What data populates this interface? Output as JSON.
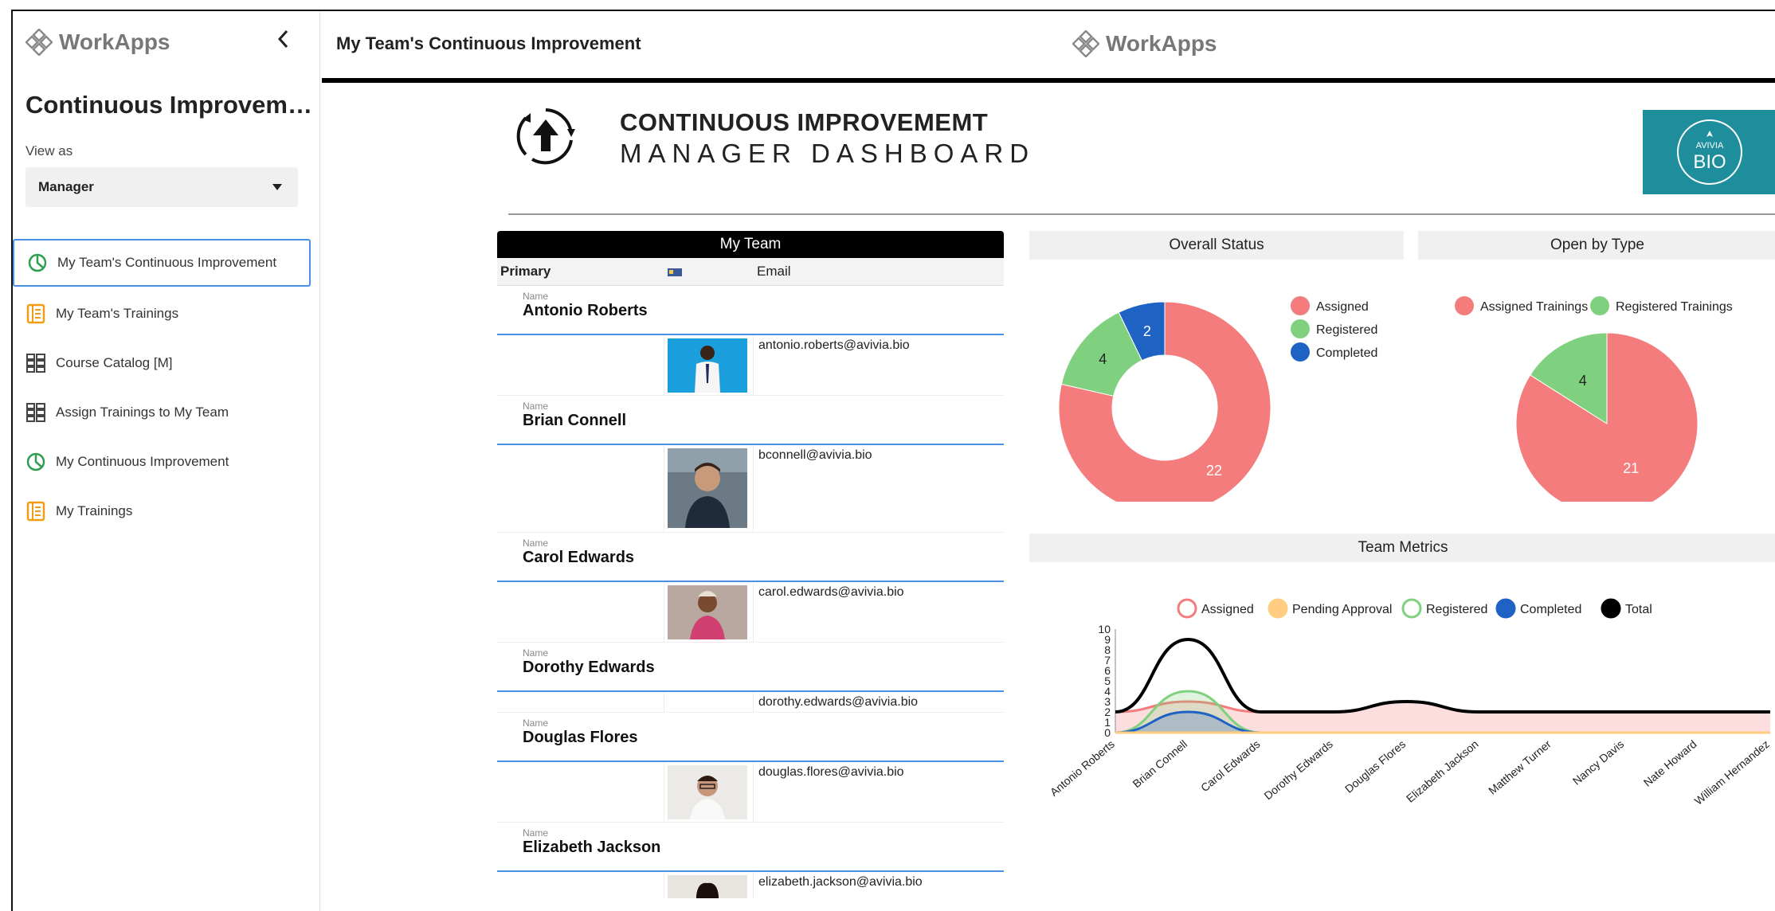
{
  "app": {
    "brand": "WorkApps",
    "title": "Continuous Improvem…",
    "view_as_label": "View as",
    "view_as_value": "Manager"
  },
  "sidebar": {
    "items": [
      {
        "label": "My Team's Continuous Improvement",
        "icon": "pie-chart-icon",
        "active": true
      },
      {
        "label": "My Team's Trainings",
        "icon": "list-document-icon",
        "active": false
      },
      {
        "label": "Course Catalog [M]",
        "icon": "grid-list-icon",
        "active": false
      },
      {
        "label": "Assign Trainings to My Team",
        "icon": "grid-list-icon",
        "active": false
      },
      {
        "label": "My Continuous Improvement",
        "icon": "pie-chart-icon",
        "active": false
      },
      {
        "label": "My Trainings",
        "icon": "list-document-icon",
        "active": false
      }
    ]
  },
  "header": {
    "page_title": "My Team's Continuous Improvement",
    "brand": "WorkApps"
  },
  "dashboard": {
    "title_line1": "CONTINUOUS IMPROVEMEMT",
    "title_line2": "MANAGER DASHBOARD",
    "logo_top": "AVIVIA",
    "logo_bottom": "BIO"
  },
  "team": {
    "header": "My Team",
    "columns": [
      "Primary",
      "",
      "Email"
    ],
    "name_label": "Name",
    "members": [
      {
        "name": "Antonio Roberts",
        "email": "antonio.roberts@avivia.bio",
        "has_photo": true
      },
      {
        "name": "Brian Connell",
        "email": "bconnell@avivia.bio",
        "has_photo": true
      },
      {
        "name": "Carol Edwards",
        "email": "carol.edwards@avivia.bio",
        "has_photo": true
      },
      {
        "name": "Dorothy Edwards",
        "email": "dorothy.edwards@avivia.bio",
        "has_photo": false
      },
      {
        "name": "Douglas Flores",
        "email": "douglas.flores@avivia.bio",
        "has_photo": true
      },
      {
        "name": "Elizabeth Jackson",
        "email": "elizabeth.jackson@avivia.bio",
        "has_photo": true
      }
    ]
  },
  "colors": {
    "assigned": "#f47c7c",
    "registered": "#7fd17f",
    "completed": "#1e63c4",
    "pending": "#ffcc80",
    "total": "#000000",
    "accent": "#4a90e2"
  },
  "chart_data": [
    {
      "type": "pie",
      "title": "Overall Status",
      "donut": true,
      "labels": [
        "Assigned",
        "Registered",
        "Completed"
      ],
      "values": [
        22,
        4,
        2
      ],
      "legend": "right"
    },
    {
      "type": "pie",
      "title": "Open by Type",
      "donut": false,
      "labels": [
        "Assigned Trainings",
        "Registered Trainings"
      ],
      "values": [
        21,
        4
      ],
      "legend": "top"
    },
    {
      "type": "area",
      "title": "Team Metrics",
      "categories": [
        "Antonio Roberts",
        "Brian Connell",
        "Carol Edwards",
        "Dorothy Edwards",
        "Douglas Flores",
        "Elizabeth Jackson",
        "Matthew Turner",
        "Nancy Davis",
        "Nate Howard",
        "William Hernandez"
      ],
      "series": [
        {
          "name": "Assigned",
          "values": [
            2,
            3,
            2,
            2,
            3,
            2,
            2,
            2,
            2,
            2
          ]
        },
        {
          "name": "Pending Approval",
          "values": [
            0,
            0,
            0,
            0,
            0,
            0,
            0,
            0,
            0,
            0
          ]
        },
        {
          "name": "Registered",
          "values": [
            0,
            4,
            0,
            0,
            0,
            0,
            0,
            0,
            0,
            0
          ]
        },
        {
          "name": "Completed",
          "values": [
            0,
            2,
            0,
            0,
            0,
            0,
            0,
            0,
            0,
            0
          ]
        },
        {
          "name": "Total",
          "values": [
            2,
            9,
            2,
            2,
            3,
            2,
            2,
            2,
            2,
            2
          ]
        }
      ],
      "ylim": [
        0,
        10
      ],
      "yticks": [
        0,
        1,
        2,
        3,
        4,
        5,
        6,
        7,
        8,
        9,
        10
      ],
      "legend": "top"
    }
  ]
}
